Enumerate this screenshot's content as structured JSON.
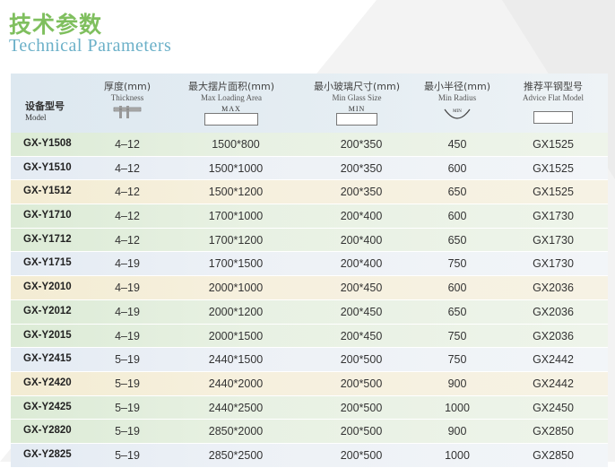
{
  "title": {
    "cn": "技术参数",
    "en": "Technical Parameters"
  },
  "header": {
    "model": {
      "cn": "设备型号",
      "en": "Model"
    },
    "thickness": {
      "cn": "厚度(mm)",
      "en": "Thickness"
    },
    "max_loading": {
      "cn": "最大摆片面积(mm)",
      "en": "Max Loading Area",
      "box": "MAX"
    },
    "min_glass": {
      "cn": "最小玻璃尺寸(mm)",
      "en": "Min Glass Size",
      "box": "MIN"
    },
    "min_radius": {
      "cn": "最小半径(mm)",
      "en": "Min Radius",
      "arc": "MIN"
    },
    "flat_model": {
      "cn": "推荐平钢型号",
      "en": "Advice Flat Model"
    }
  },
  "colors": {
    "title_cn": "#7fbf5e",
    "title_en": "#6bb0c8",
    "row_green": "#dcebd6",
    "row_blue": "#e4ebf3",
    "row_yellow": "#f3ecd3"
  },
  "rows": [
    {
      "model": "GX-Y1508",
      "thickness": "4–12",
      "max_loading": "1500*800",
      "min_glass": "200*350",
      "min_radius": "450",
      "flat_model": "GX1525",
      "tone": "green"
    },
    {
      "model": "GX-Y1510",
      "thickness": "4–12",
      "max_loading": "1500*1000",
      "min_glass": "200*350",
      "min_radius": "600",
      "flat_model": "GX1525",
      "tone": "blue"
    },
    {
      "model": "GX-Y1512",
      "thickness": "4–12",
      "max_loading": "1500*1200",
      "min_glass": "200*350",
      "min_radius": "650",
      "flat_model": "GX1525",
      "tone": "yellow"
    },
    {
      "model": "GX-Y1710",
      "thickness": "4–12",
      "max_loading": "1700*1000",
      "min_glass": "200*400",
      "min_radius": "600",
      "flat_model": "GX1730",
      "tone": "green"
    },
    {
      "model": "GX-Y1712",
      "thickness": "4–12",
      "max_loading": "1700*1200",
      "min_glass": "200*400",
      "min_radius": "650",
      "flat_model": "GX1730",
      "tone": "green"
    },
    {
      "model": "GX-Y1715",
      "thickness": "4–19",
      "max_loading": "1700*1500",
      "min_glass": "200*400",
      "min_radius": "750",
      "flat_model": "GX1730",
      "tone": "blue"
    },
    {
      "model": "GX-Y2010",
      "thickness": "4–19",
      "max_loading": "2000*1000",
      "min_glass": "200*450",
      "min_radius": "600",
      "flat_model": "GX2036",
      "tone": "yellow"
    },
    {
      "model": "GX-Y2012",
      "thickness": "4–19",
      "max_loading": "2000*1200",
      "min_glass": "200*450",
      "min_radius": "650",
      "flat_model": "GX2036",
      "tone": "green"
    },
    {
      "model": "GX-Y2015",
      "thickness": "4–19",
      "max_loading": "2000*1500",
      "min_glass": "200*450",
      "min_radius": "750",
      "flat_model": "GX2036",
      "tone": "green"
    },
    {
      "model": "GX-Y2415",
      "thickness": "5–19",
      "max_loading": "2440*1500",
      "min_glass": "200*500",
      "min_radius": "750",
      "flat_model": "GX2442",
      "tone": "blue"
    },
    {
      "model": "GX-Y2420",
      "thickness": "5–19",
      "max_loading": "2440*2000",
      "min_glass": "200*500",
      "min_radius": "900",
      "flat_model": "GX2442",
      "tone": "yellow"
    },
    {
      "model": "GX-Y2425",
      "thickness": "5–19",
      "max_loading": "2440*2500",
      "min_glass": "200*500",
      "min_radius": "1000",
      "flat_model": "GX2450",
      "tone": "green"
    },
    {
      "model": "GX-Y2820",
      "thickness": "5–19",
      "max_loading": "2850*2000",
      "min_glass": "200*500",
      "min_radius": "900",
      "flat_model": "GX2850",
      "tone": "green"
    },
    {
      "model": "GX-Y2825",
      "thickness": "5–19",
      "max_loading": "2850*2500",
      "min_glass": "200*500",
      "min_radius": "1000",
      "flat_model": "GX2850",
      "tone": "blue"
    }
  ]
}
